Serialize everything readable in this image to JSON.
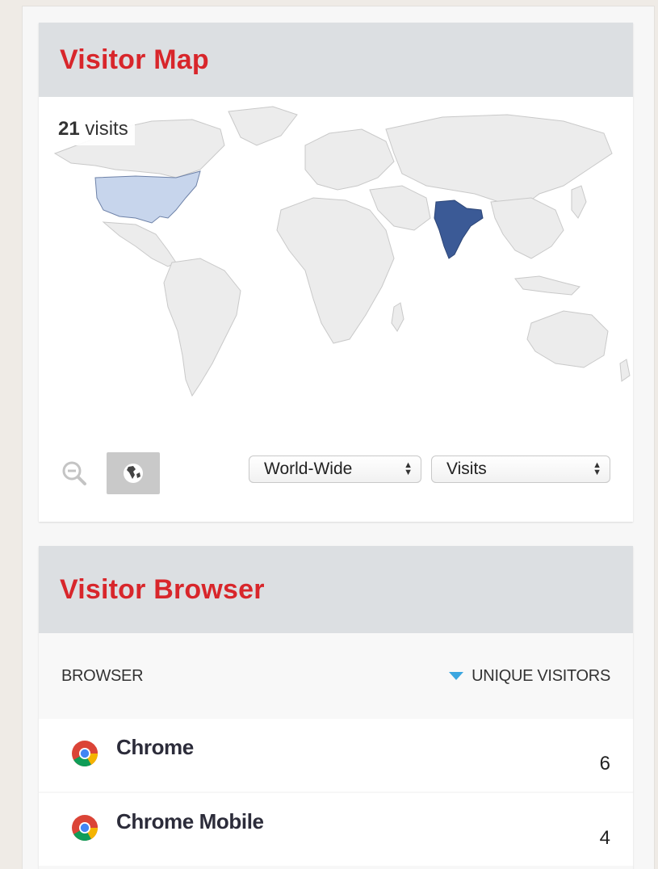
{
  "visitor_map": {
    "title": "Visitor Map",
    "visits_count": "21",
    "visits_label": "visits",
    "region_select": "World-Wide",
    "metric_select": "Visits",
    "highlight_colors": {
      "India": "#3b5a96",
      "United States": "#c7d5ec",
      "other": "#ececec"
    }
  },
  "visitor_browser": {
    "title": "Visitor Browser",
    "col_browser": "BROWSER",
    "col_unique": "UNIQUE VISITORS",
    "rows": [
      {
        "name": "Chrome",
        "count": "6",
        "icon": "chrome-icon"
      },
      {
        "name": "Chrome Mobile",
        "count": "4",
        "icon": "chrome-icon"
      }
    ]
  },
  "colors": {
    "title_red": "#d8262b",
    "header_gray": "#dcdfe2",
    "sort_blue": "#3ba6e0"
  }
}
